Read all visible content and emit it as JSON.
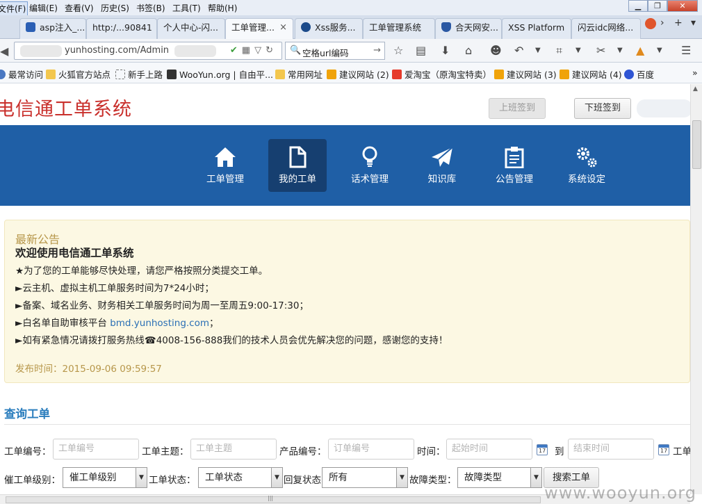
{
  "menubar": {
    "items": [
      "文件(F)",
      "编辑(E)",
      "查看(V)",
      "历史(S)",
      "书签(B)",
      "工具(T)",
      "帮助(H)"
    ]
  },
  "tabs": [
    {
      "label": "asp注入_...",
      "icon_color": "#2b5fb4"
    },
    {
      "label": "http:/...90841",
      "icon_color": ""
    },
    {
      "label": "个人中心-闪...",
      "icon_color": ""
    },
    {
      "label": "工单管理...",
      "icon_color": "",
      "active": true
    },
    {
      "label": "Xss服务...",
      "icon_color": "#1b4a8a"
    },
    {
      "label": "工单管理系统",
      "icon_color": ""
    },
    {
      "label": "合天网安...",
      "icon_color": "#2a58a3"
    },
    {
      "label": "XSS Platform",
      "icon_color": ""
    },
    {
      "label": "闪云idc网络...",
      "icon_color": ""
    }
  ],
  "tab_controls": {
    "close": "×",
    "scroll": "›",
    "new": "+",
    "list": "▾"
  },
  "navbar": {
    "url": "yunhosting.com/Admin",
    "url_tail": "a",
    "search_text": "空格url编码"
  },
  "bookmarks": [
    {
      "label": "最常访问",
      "icon": "gear-icon",
      "color": "#4a78c2"
    },
    {
      "label": "火狐官方站点",
      "icon": "folder-icon",
      "color": "#f3c74e"
    },
    {
      "label": "新手上路",
      "icon": "page-icon",
      "color": "#ffffff"
    },
    {
      "label": "WooYun.org | 自由平...",
      "icon": "wooyun-icon",
      "color": "#333333"
    },
    {
      "label": "常用网址",
      "icon": "folder-icon",
      "color": "#f3c74e"
    },
    {
      "label": "建议网站 (2)",
      "icon": "bing-icon",
      "color": "#f0a30a"
    },
    {
      "label": "爱淘宝（原淘宝特卖）",
      "icon": "taobao-icon",
      "color": "#e63a2b"
    },
    {
      "label": "建议网站 (3)",
      "icon": "bing-icon",
      "color": "#f0a30a"
    },
    {
      "label": "建议网站 (4)",
      "icon": "bing-icon",
      "color": "#f0a30a"
    },
    {
      "label": "百度",
      "icon": "baidu-icon",
      "color": "#2f55d4"
    }
  ],
  "page": {
    "title": "电信通工单系统",
    "btn_clock_in": "上班签到",
    "btn_clock_out": "下班签到"
  },
  "nav": [
    {
      "label": "工单管理",
      "icon": "home-icon"
    },
    {
      "label": "我的工单",
      "icon": "document-icon",
      "active": true
    },
    {
      "label": "话术管理",
      "icon": "lightbulb-icon"
    },
    {
      "label": "知识库",
      "icon": "paper-plane-icon"
    },
    {
      "label": "公告管理",
      "icon": "clipboard-icon"
    },
    {
      "label": "系统设定",
      "icon": "gears-icon"
    }
  ],
  "notice": {
    "heading": "最新公告",
    "title": "欢迎使用电信通工单系统",
    "line1": "★为了您的工单能够尽快处理，请您严格按照分类提交工单。",
    "line2": "►云主机、虚拟主机工单服务时间为7*24小时；",
    "line3": "►备案、域名业务、财务相关工单服务时间为周一至周五9:00-17:30；",
    "line4_pre": "►白名单自助审核平台 ",
    "line4_link": "bmd.yunhosting.com",
    "line4_post": "；",
    "line5": "►如有紧急情况请拨打服务热线☎4008-156-888我们的技术人员会优先解决您的问题，感谢您的支持！",
    "published": "发布时间：2015-09-06 09:59:57"
  },
  "query": {
    "title": "查询工单",
    "ticket_no_label": "工单编号：",
    "ticket_no_placeholder": "工单编号",
    "subject_label": "工单主题：",
    "subject_placeholder": "工单主题",
    "product_label": "产品编号：",
    "product_placeholder": "订单编号",
    "time_label": "时间：",
    "start_placeholder": "起始时间",
    "to_label": "到",
    "end_placeholder": "结束时间",
    "more_label": "工单",
    "urge_label": "催工单级别：",
    "urge_value": "催工单级别",
    "status_label": "工单状态：",
    "status_value": "工单状态",
    "reply_label": "回复状态：",
    "reply_value": "所有",
    "fault_label": "故障类型：",
    "fault_value": "故障类型",
    "search_btn": "搜索工单",
    "cal_text": "17"
  },
  "watermark": "www.wooyun.org"
}
